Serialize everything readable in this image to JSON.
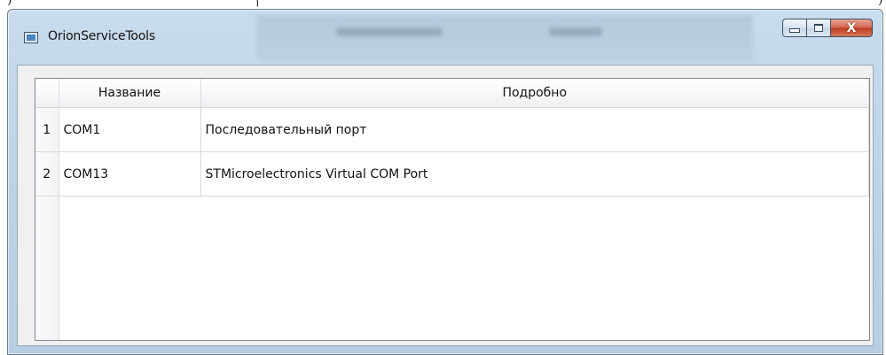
{
  "window": {
    "title": "OrionServiceTools",
    "app_icon": "window-app-icon",
    "controls": {
      "minimize_icon": "minimize-icon",
      "maximize_icon": "maximize-icon",
      "close_glyph": "X"
    },
    "close_color": "#c8452a",
    "frame_color": "#bfd4e8"
  },
  "table": {
    "columns": [
      "Название",
      "Подробно"
    ],
    "rows": [
      {
        "num": "1",
        "name": "COM1",
        "details": "Последовательный порт"
      },
      {
        "num": "2",
        "name": "COM13",
        "details": "STMicroelectronics Virtual COM Port"
      }
    ]
  }
}
